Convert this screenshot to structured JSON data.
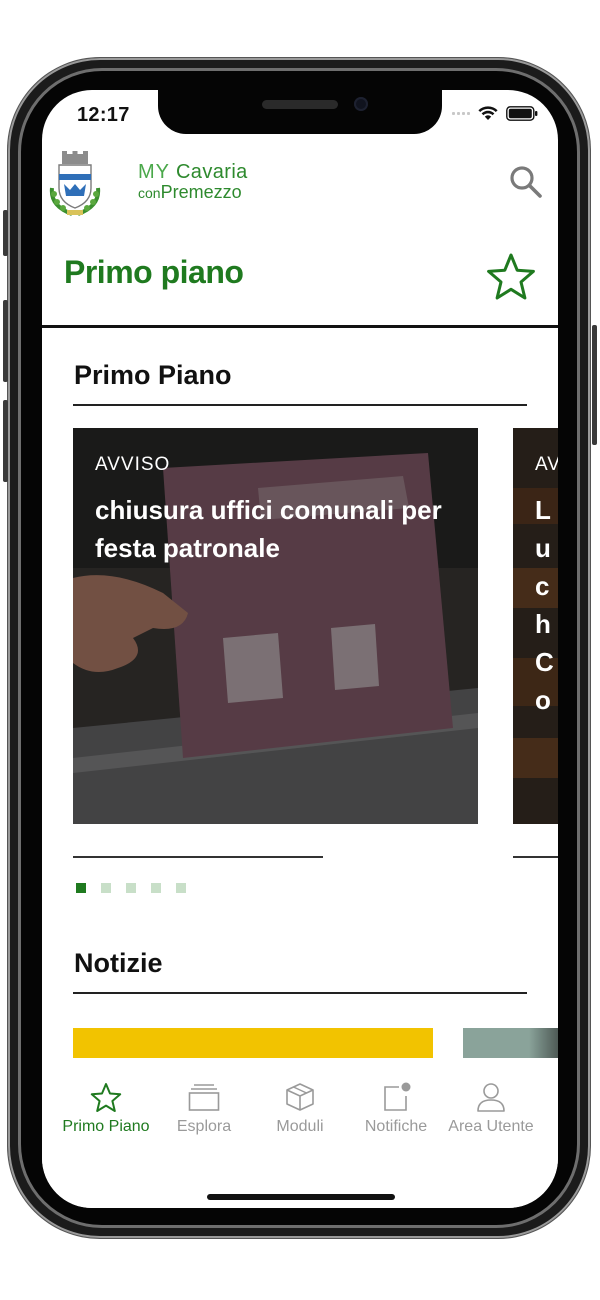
{
  "status": {
    "time": "12:17"
  },
  "header": {
    "brand_my": "MY",
    "brand_cavaria": "Cavaria",
    "brand_con": "con",
    "brand_premezzo": "Premezzo",
    "page_title": "Primo piano"
  },
  "primo_piano": {
    "section_title": "Primo Piano",
    "cards": [
      {
        "category": "AVVISO",
        "title": "chiusura uffici comunali per festa patronale"
      },
      {
        "category": "AV",
        "title": "Lu ch Co"
      }
    ],
    "pager": {
      "count": 5,
      "active_index": 1
    }
  },
  "notizie": {
    "section_title": "Notizie"
  },
  "bottom_nav": {
    "items": [
      {
        "label": "Primo Piano",
        "icon": "star-icon",
        "active": true
      },
      {
        "label": "Esplora",
        "icon": "stack-icon",
        "active": false
      },
      {
        "label": "Moduli",
        "icon": "box-icon",
        "active": false
      },
      {
        "label": "Notifiche",
        "icon": "notification-icon",
        "active": false
      },
      {
        "label": "Area Utente",
        "icon": "user-icon",
        "active": false
      }
    ]
  },
  "colors": {
    "brand_green": "#1f7a1f",
    "inactive_gray": "#9a9a9a",
    "card_yellow": "#f2c300"
  }
}
